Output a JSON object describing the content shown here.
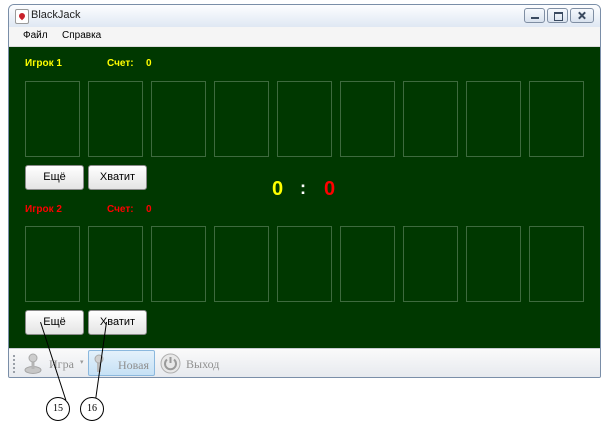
{
  "window": {
    "title": "BlackJack"
  },
  "menu": {
    "items": [
      "Файл",
      "Справка"
    ]
  },
  "player1": {
    "name": "Игрок 1",
    "score_label": "Счет:",
    "score": "0",
    "color": "#ffff00",
    "more_label": "Ещё",
    "stop_label": "Хватит"
  },
  "player2": {
    "name": "Игрок 2",
    "score_label": "Счет:",
    "score": "0",
    "color": "#ff0000",
    "more_label": "Ещё",
    "stop_label": "Хватит"
  },
  "tally": {
    "left": "0",
    "separator": ":",
    "right": "0"
  },
  "colors": {
    "table": "#003800",
    "card_slot_border": "#3e6a3e"
  },
  "toolbar": {
    "game_label": "Игра",
    "new_label": "Новая",
    "exit_label": "Выход"
  },
  "callouts": [
    "15",
    "16"
  ]
}
